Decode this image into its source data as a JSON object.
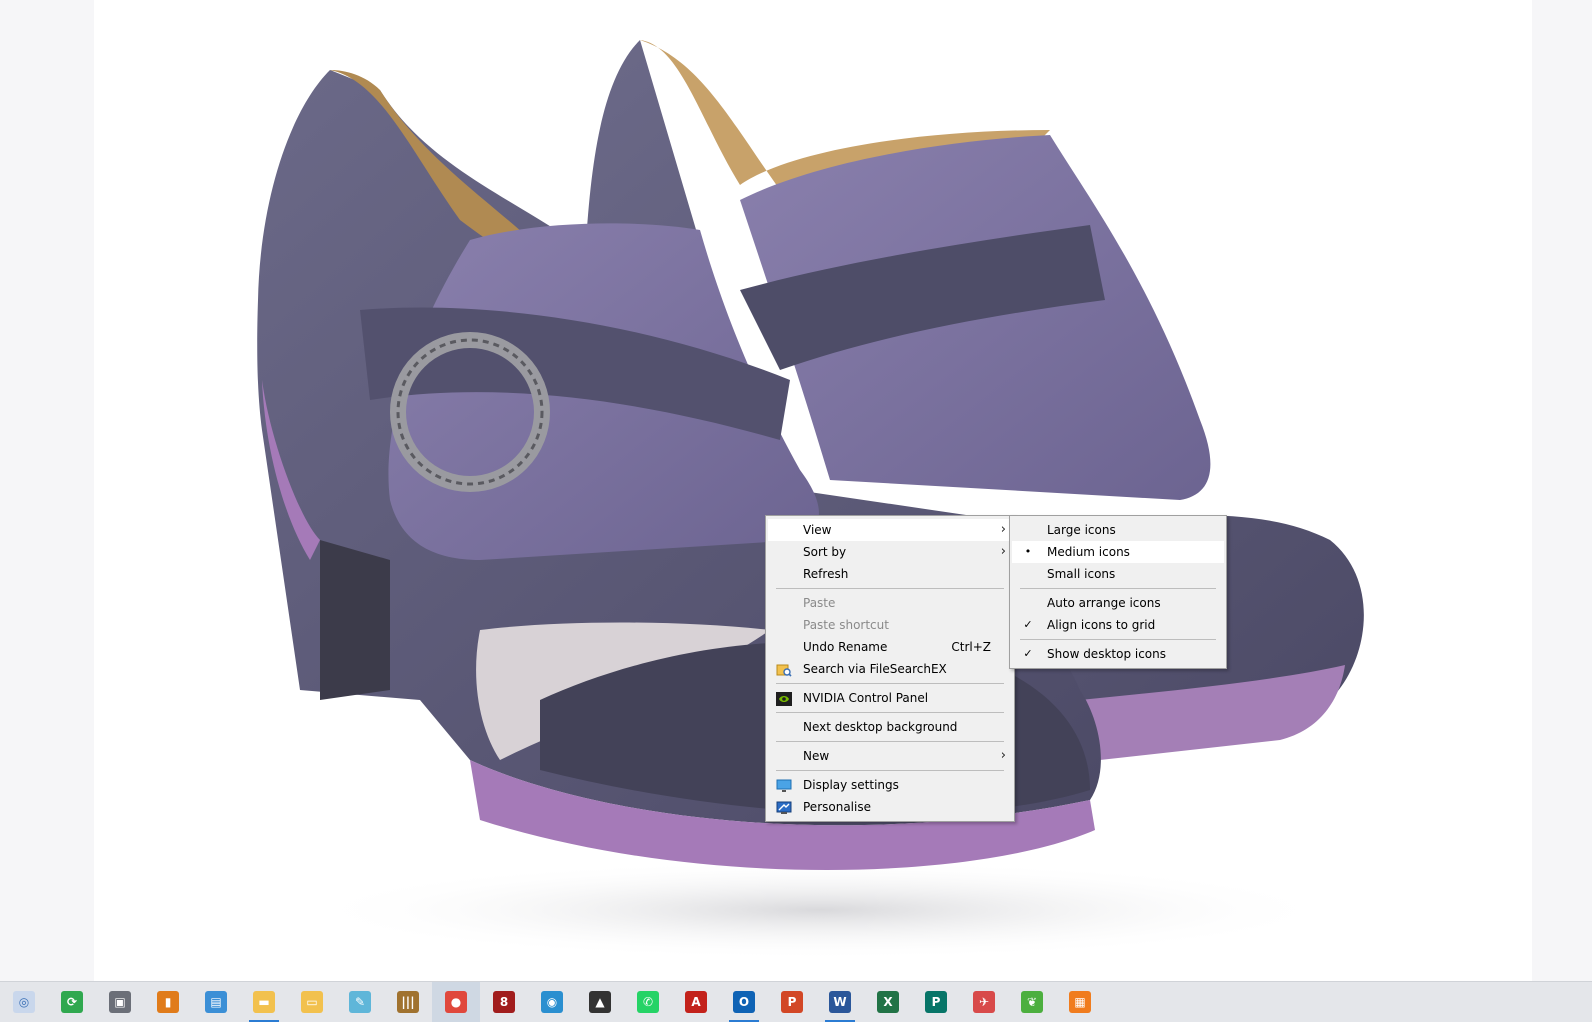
{
  "context_menu": {
    "items": [
      {
        "label": "View",
        "submenu": true,
        "highlighted": true
      },
      {
        "label": "Sort by",
        "submenu": true
      },
      {
        "label": "Refresh"
      },
      {
        "separator": true
      },
      {
        "label": "Paste",
        "disabled": true
      },
      {
        "label": "Paste shortcut",
        "disabled": true
      },
      {
        "label": "Undo Rename",
        "shortcut": "Ctrl+Z"
      },
      {
        "label": "Search via FileSearchEX",
        "icon": "filesearch-icon"
      },
      {
        "separator": true
      },
      {
        "label": "NVIDIA Control Panel",
        "icon": "nvidia-icon"
      },
      {
        "separator": true
      },
      {
        "label": "Next desktop background"
      },
      {
        "separator": true
      },
      {
        "label": "New",
        "submenu": true
      },
      {
        "separator": true
      },
      {
        "label": "Display settings",
        "icon": "display-icon"
      },
      {
        "label": "Personalise",
        "icon": "personalise-icon"
      }
    ],
    "submenu_arrow": "›"
  },
  "view_submenu": {
    "items": [
      {
        "label": "Large icons"
      },
      {
        "label": "Medium icons",
        "mark": "•",
        "highlighted": true
      },
      {
        "label": "Small icons"
      },
      {
        "separator": true
      },
      {
        "label": "Auto arrange icons"
      },
      {
        "label": "Align icons to grid",
        "mark": "✓"
      },
      {
        "separator": true
      },
      {
        "label": "Show desktop icons",
        "mark": "✓"
      }
    ]
  },
  "taskbar": {
    "icons": [
      {
        "name": "recovery-icon",
        "color": "#c9d7ec",
        "glyph": "◎",
        "fg": "#3a6fb5"
      },
      {
        "name": "sync-icon",
        "color": "#2fa84f",
        "glyph": "⟳"
      },
      {
        "name": "forklift-icon",
        "color": "#6b6f78",
        "glyph": "▣"
      },
      {
        "name": "archive-icon",
        "color": "#e07b1a",
        "glyph": "▮"
      },
      {
        "name": "control-panel-icon",
        "color": "#3b8fd6",
        "glyph": "▤"
      },
      {
        "name": "file-explorer-icon",
        "color": "#f2c14e",
        "glyph": "▬",
        "underline": true
      },
      {
        "name": "folder-search-icon",
        "color": "#f2c14e",
        "glyph": "▭"
      },
      {
        "name": "notepad-icon",
        "color": "#5fb6d9",
        "glyph": "✎"
      },
      {
        "name": "library-icon",
        "color": "#a0722f",
        "glyph": "|||"
      },
      {
        "name": "chrome-icon",
        "color": "#e0483c",
        "glyph": "●",
        "active": true
      },
      {
        "name": "paint-shop-icon",
        "color": "#a11d1d",
        "glyph": "8"
      },
      {
        "name": "camera-icon",
        "color": "#2a8fd0",
        "glyph": "◉"
      },
      {
        "name": "photos-icon",
        "color": "#333333",
        "glyph": "▲"
      },
      {
        "name": "whatsapp-icon",
        "color": "#25d366",
        "glyph": "✆"
      },
      {
        "name": "acrobat-icon",
        "color": "#c3221b",
        "glyph": "A"
      },
      {
        "name": "outlook-icon",
        "color": "#0f63b5",
        "glyph": "O",
        "underline": true
      },
      {
        "name": "powerpoint-icon",
        "color": "#d24726",
        "glyph": "P"
      },
      {
        "name": "word-icon",
        "color": "#2b579a",
        "glyph": "W",
        "underline": true
      },
      {
        "name": "excel-icon",
        "color": "#217346",
        "glyph": "X"
      },
      {
        "name": "publisher-icon",
        "color": "#077568",
        "glyph": "P"
      },
      {
        "name": "tool-icon",
        "color": "#d84a4a",
        "glyph": "✈"
      },
      {
        "name": "leaf-icon",
        "color": "#4caf3f",
        "glyph": "❦"
      },
      {
        "name": "pdf-tool-icon",
        "color": "#f07c1e",
        "glyph": "▦"
      }
    ]
  }
}
